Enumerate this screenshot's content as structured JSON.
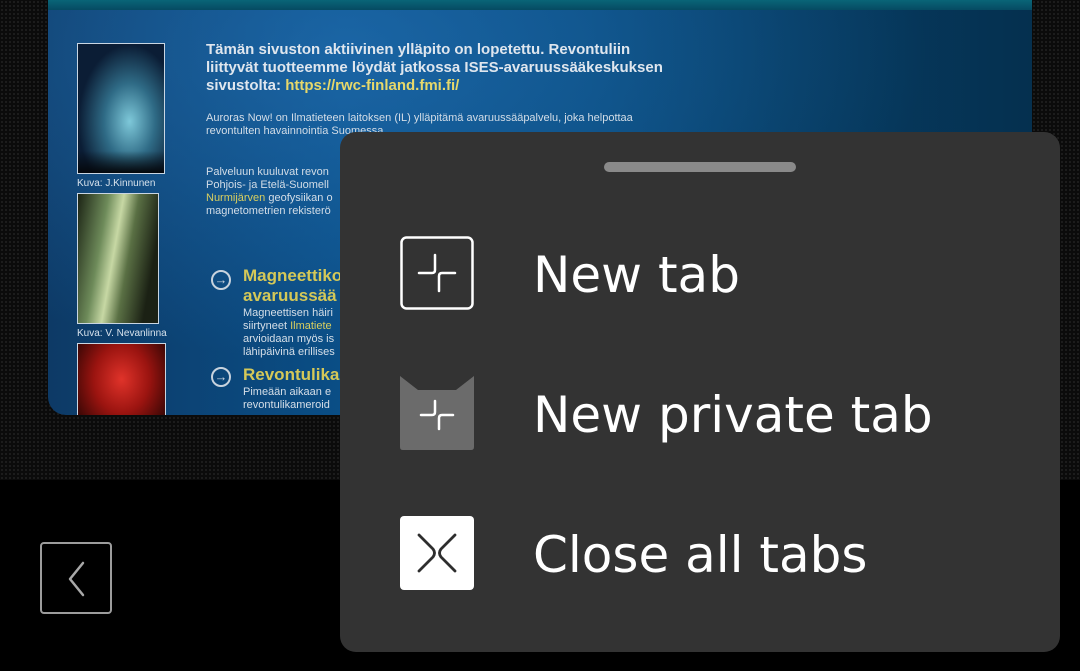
{
  "webpage": {
    "notice_line1": "Tämän sivuston aktiivinen ylläpito on lopetettu. Revontuliin",
    "notice_line2": "liittyvät tuotteemme löydät jatkossa ISES-avaruussääkeskuksen",
    "notice_line3_prefix": "sivustolta: ",
    "notice_link": "https://rwc-finland.fmi.fi/",
    "para1_line1": "Auroras Now! on Ilmatieteen laitoksen (IL) ylläpitämä avaruussääpalvelu, joka helpottaa",
    "para1_line2": "revontulten havainnointia Suomessa.",
    "para2_line1": "Palveluun kuuluvat revon",
    "para2_line2": "Pohjois- ja Etelä-Suomell",
    "para2_line3_link": "Nurmijärven",
    "para2_line3_rest": " geofysiikan o",
    "para2_line4": "magnetometrien rekisterö",
    "caption1": "Kuva: J.Kinnunen",
    "caption2": "Kuva: V. Nevanlinna",
    "section1_heading_line1": "Magneettiko",
    "section1_heading_line2": "avaruussää",
    "section1_line1": "Magneettisen häiri",
    "section1_line2_prefix": "siirtyneet ",
    "section1_line2_link": "Ilmatiete",
    "section1_line3": "arvioidaan myös is",
    "section1_line4": "lähipäivinä erillises",
    "section2_heading": "Revontulika",
    "section2_line1": "Pimeään aikaan e",
    "section2_line2": "revontulikameroid"
  },
  "menu": {
    "items": [
      {
        "label": "New tab",
        "icon": "new-tab-icon"
      },
      {
        "label": "New private tab",
        "icon": "private-tab-icon"
      },
      {
        "label": "Close all tabs",
        "icon": "close-all-icon"
      }
    ]
  },
  "colors": {
    "sheet_background": "#333333",
    "link_yellow": "#e7d86a",
    "heading_yellow": "#d4c858"
  }
}
